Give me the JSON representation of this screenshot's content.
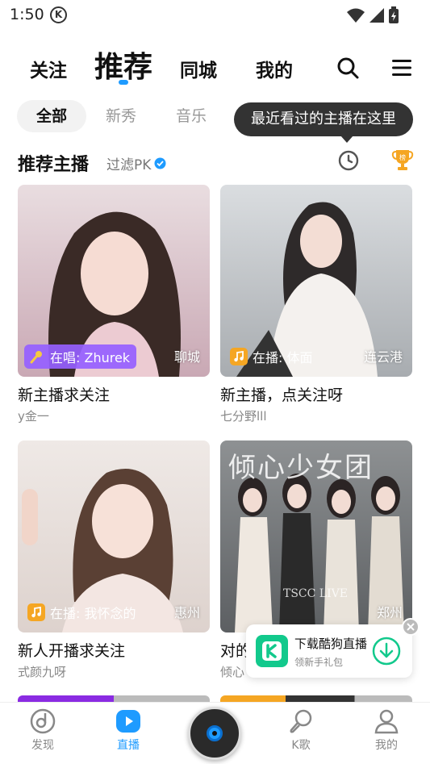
{
  "status_bar": {
    "time": "1:50",
    "k_icon": "K"
  },
  "top_nav": {
    "tabs": [
      {
        "label": "关注",
        "active": false
      },
      {
        "label": "推荐",
        "active": true
      },
      {
        "label": "同城",
        "active": false
      },
      {
        "label": "我的",
        "active": false
      }
    ],
    "icons": [
      "search-icon",
      "menu-icon"
    ]
  },
  "categories": {
    "chips": [
      "全部",
      "新秀",
      "音乐"
    ],
    "active": "全部"
  },
  "tooltip": "最近看过的主播在这里",
  "section": {
    "title": "推荐主播",
    "filter": "过滤PK",
    "trophy_label": "榜"
  },
  "streamers": [
    {
      "status": "在唱: Zhurek",
      "status_type": "singing",
      "city": "聊城",
      "title": "新主播求关注",
      "name": "y金一"
    },
    {
      "status": "在播: 体面",
      "status_type": "music",
      "city": "连云港",
      "title": "新主播，点关注呀",
      "name": "七分野lll"
    },
    {
      "status": "在播: 我怀念的",
      "status_type": "music",
      "city": "惠州",
      "title": "新人开播求关注",
      "name": "式颜九呀"
    },
    {
      "status": "",
      "status_type": "none",
      "city": "郑州",
      "title": "对的",
      "name": "倾心",
      "cover_text": "倾心少女团",
      "cover_small": "TSCC LIVE"
    }
  ],
  "promo": {
    "title": "下载酷狗直播",
    "subtitle": "领新手礼包"
  },
  "bottom_nav": [
    {
      "label": "发现",
      "icon": "discover-icon",
      "active": false
    },
    {
      "label": "直播",
      "icon": "live-icon",
      "active": true
    },
    {
      "label": "",
      "icon": "music-disc-icon",
      "active": false
    },
    {
      "label": "K歌",
      "icon": "karaoke-mic-icon",
      "active": false
    },
    {
      "label": "我的",
      "icon": "profile-icon",
      "active": false
    }
  ],
  "colors": {
    "accent": "#1e9bff",
    "sing_badge": "#965fff",
    "music_badge": "#f5a623",
    "promo_green": "#12c98c",
    "trophy": "#f5a623"
  }
}
